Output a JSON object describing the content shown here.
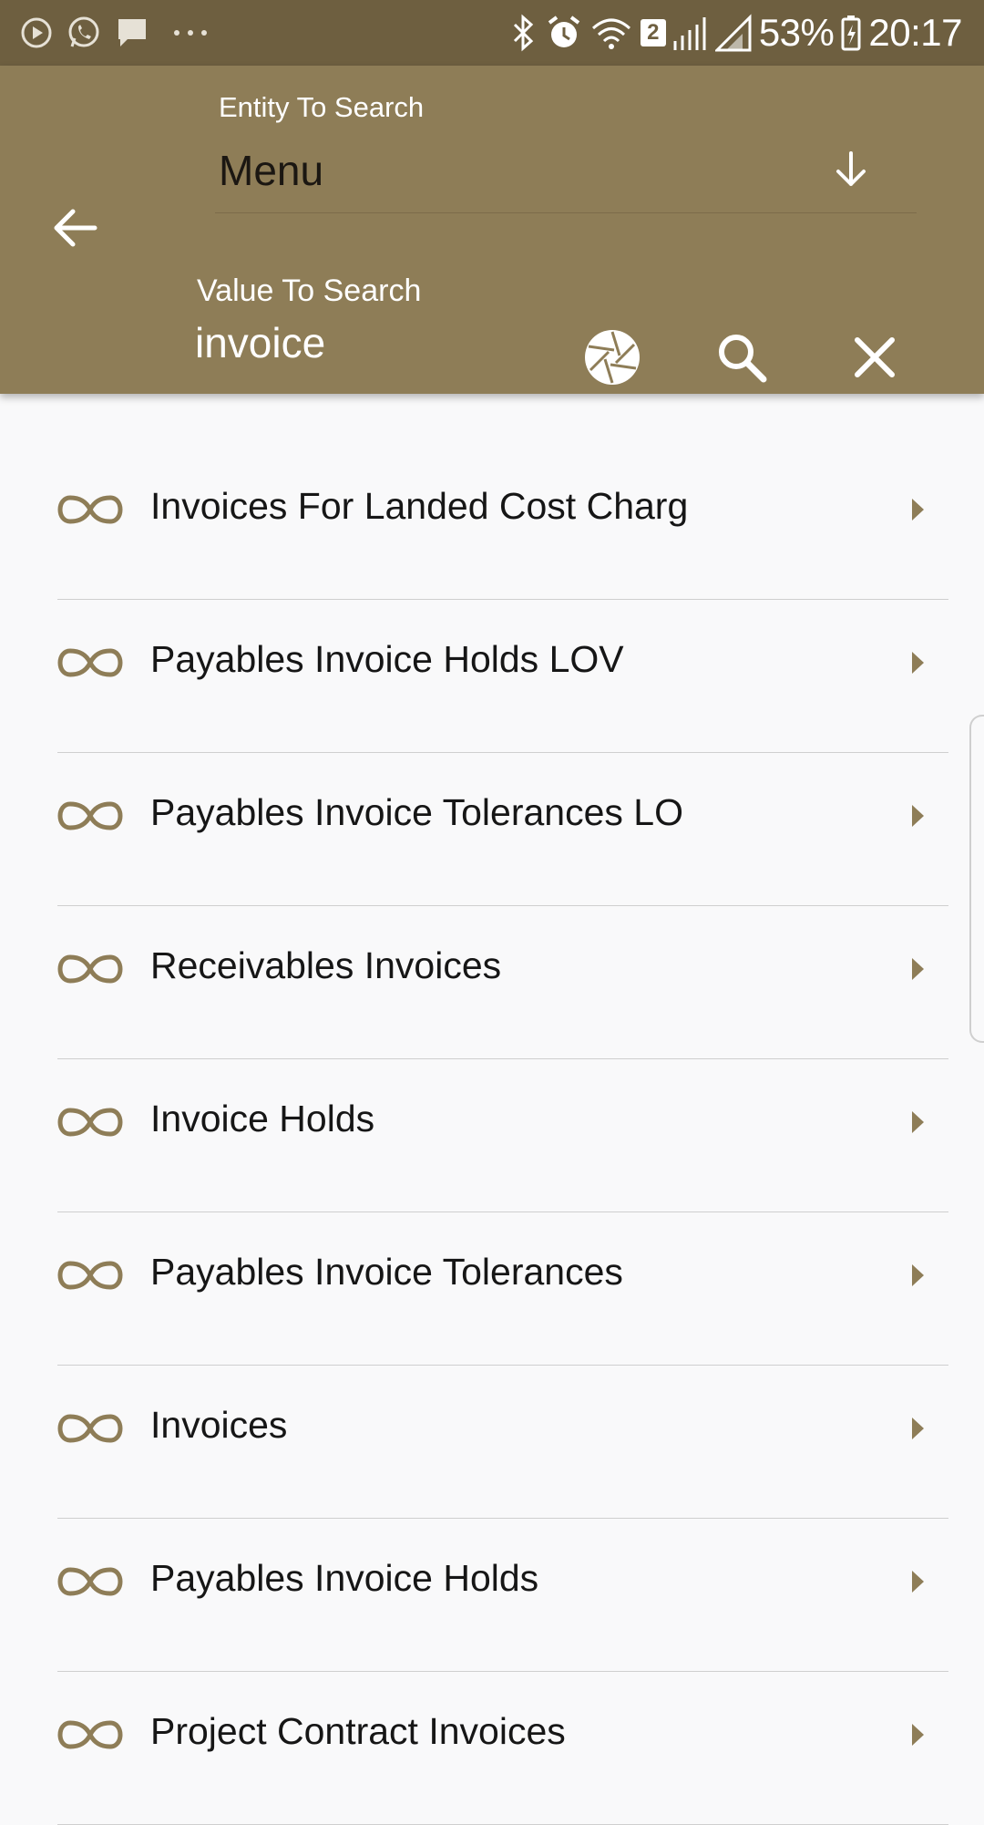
{
  "status_bar": {
    "left_icons": [
      "play-icon",
      "whatsapp-icon",
      "message-icon",
      "more-dots-icon"
    ],
    "right_icons": [
      "bluetooth-icon",
      "alarm-icon",
      "wifi-icon",
      "sim2-icon",
      "signal-icon",
      "signal-icon",
      "battery-icon"
    ],
    "sim_badge": "2",
    "battery_percent": "53%",
    "time": "20:17"
  },
  "header": {
    "entity_label": "Entity To Search",
    "entity_value": "Menu",
    "value_label": "Value To Search",
    "value_input": "invoice"
  },
  "results": {
    "item_icon": "infinity-link-icon",
    "items": [
      {
        "label": "Invoices For Landed Cost Charg"
      },
      {
        "label": "Payables Invoice Holds LOV"
      },
      {
        "label": "Payables Invoice Tolerances LO"
      },
      {
        "label": "Receivables Invoices"
      },
      {
        "label": "Invoice Holds"
      },
      {
        "label": "Payables Invoice Tolerances"
      },
      {
        "label": "Invoices"
      },
      {
        "label": "Payables Invoice Holds"
      },
      {
        "label": "Project Contract Invoices"
      }
    ]
  },
  "colors": {
    "status_bar": "#6e5f40",
    "header": "#8e7d57",
    "accent": "#8e7d57",
    "background": "#f9f9fa"
  }
}
